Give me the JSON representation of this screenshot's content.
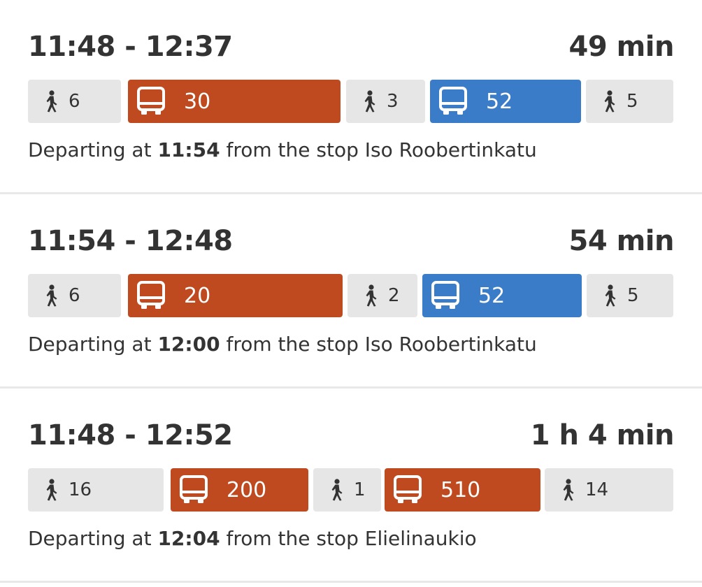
{
  "colors": {
    "bus_orange": "#bf4a20",
    "bus_blue": "#3a7cc8",
    "walk_bg": "#e6e6e6",
    "text": "#333333"
  },
  "departure_text": {
    "prefix": "Departing at",
    "middle": "from the stop"
  },
  "routes": [
    {
      "time_range": "11:48 - 12:37",
      "duration": "49 min",
      "legs": [
        {
          "type": "walk",
          "label": "6",
          "icon": "walk-icon"
        },
        {
          "type": "bus",
          "label": "30",
          "color": "#bf4a20",
          "icon": "bus-icon"
        },
        {
          "type": "walk",
          "label": "3",
          "icon": "walk-icon"
        },
        {
          "type": "bus",
          "label": "52",
          "color": "#3a7cc8",
          "icon": "bus-icon"
        },
        {
          "type": "walk",
          "label": "5",
          "icon": "walk-icon"
        }
      ],
      "departure_time": "11:54",
      "stop": "Iso Roobertinkatu"
    },
    {
      "time_range": "11:54 - 12:48",
      "duration": "54 min",
      "legs": [
        {
          "type": "walk",
          "label": "6",
          "icon": "walk-icon"
        },
        {
          "type": "bus",
          "label": "20",
          "color": "#bf4a20",
          "icon": "bus-icon"
        },
        {
          "type": "walk",
          "label": "2",
          "icon": "walk-icon"
        },
        {
          "type": "bus",
          "label": "52",
          "color": "#3a7cc8",
          "icon": "bus-icon"
        },
        {
          "type": "walk",
          "label": "5",
          "icon": "walk-icon"
        }
      ],
      "departure_time": "12:00",
      "stop": "Iso Roobertinkatu"
    },
    {
      "time_range": "11:48 - 12:52",
      "duration": "1 h 4 min",
      "legs": [
        {
          "type": "walk",
          "label": "16",
          "icon": "walk-icon"
        },
        {
          "type": "bus",
          "label": "200",
          "color": "#bf4a20",
          "icon": "bus-icon"
        },
        {
          "type": "walk",
          "label": "1",
          "icon": "walk-icon"
        },
        {
          "type": "bus",
          "label": "510",
          "color": "#bf4a20",
          "icon": "bus-icon"
        },
        {
          "type": "walk",
          "label": "14",
          "icon": "walk-icon"
        }
      ],
      "departure_time": "12:04",
      "stop": "Elielinaukio"
    }
  ]
}
